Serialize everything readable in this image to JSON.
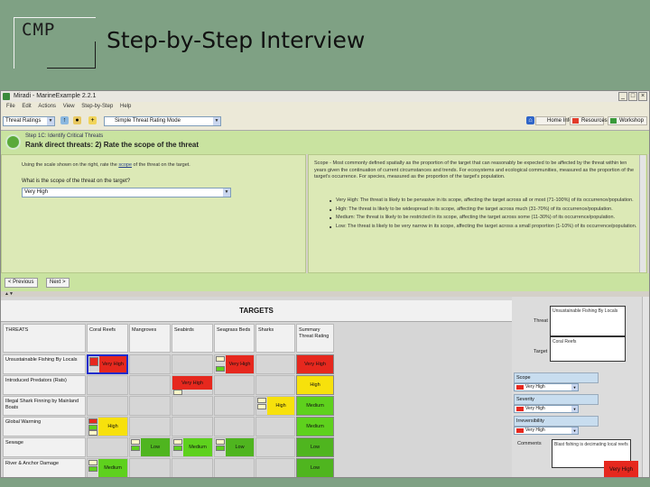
{
  "slide": {
    "logo": "CMP",
    "title": "Step-by-Step Interview"
  },
  "window": {
    "title": "Miradi - MarineExample 2.2.1",
    "menu": [
      "File",
      "Edit",
      "Actions",
      "View",
      "Step-by-Step",
      "Help"
    ]
  },
  "toolbar": {
    "view_select": "Threat Ratings",
    "mode_select": "Simple Threat Rating Mode",
    "links": [
      {
        "label": "Home Info",
        "color": "#2f65c8"
      },
      {
        "label": "Resources",
        "color": "#e23c2a"
      },
      {
        "label": "Workshop",
        "color": "#3a9a3a"
      }
    ]
  },
  "step": {
    "label": "Step 1C: Identify Critical Threats",
    "title": "Rank direct threats: 2) Rate the scope of the threat"
  },
  "question": {
    "intro_prefix": "Using the scale shown on the right, rate the",
    "intro_link": "scope",
    "intro_suffix": "of the threat on the target.",
    "text": "What is the scope of the threat on the target?",
    "answer": "Very High"
  },
  "scope_help": {
    "definition": "Scope - Most commonly defined spatially as the proportion of the target that can reasonably be expected to be affected by the threat within ten years given the continuation of current circumstances and trends. For ecosystems and ecological communities, measured as the proportion of the target's occurrence. For species, measured as the proportion of the target's population.",
    "items": [
      "Very High: The threat is likely to be pervasive in its scope, affecting the target across all or most (71-100%) of its occurrence/population.",
      "High: The threat is likely to be widespread in its scope, affecting the target across much (31-70%) of its occurrence/population.",
      "Medium: The threat is likely to be restricted in its scope, affecting the target across some (11-30%) of its occurrence/population.",
      "Low: The threat is likely to be very narrow in its scope, affecting the target across a small proportion (1-10%) of its occurrence/population."
    ]
  },
  "nav": {
    "previous": "< Previous",
    "next": "Next >"
  },
  "matrix": {
    "targets_label": "TARGETS",
    "threats_label": "THREATS",
    "summary_label": "Summary Threat Rating",
    "columns": [
      "Coral Reefs",
      "Mangroves",
      "Seabirds",
      "Seagrass Beds",
      "Sharks"
    ],
    "rows": [
      {
        "threat": "Unsustainable Fishing By Locals",
        "cells": [
          {
            "rating": "Very High",
            "color": "#e6281e"
          },
          {
            "rating": "",
            "color": ""
          },
          {
            "rating": "",
            "color": ""
          },
          {
            "rating": "Very High",
            "color": "#e6281e"
          },
          {
            "rating": "",
            "color": ""
          }
        ],
        "summary": "Very High",
        "summary_color": "#e6281e"
      },
      {
        "threat": "Introduced Predators (Rats)",
        "cells": [
          {
            "rating": "",
            "color": ""
          },
          {
            "rating": "",
            "color": ""
          },
          {
            "rating": "Very High",
            "color": "#e6281e"
          },
          {
            "rating": "",
            "color": ""
          },
          {
            "rating": "",
            "color": ""
          }
        ],
        "summary": "High",
        "summary_color": "#f7e10c"
      },
      {
        "threat": "Illegal Shark Finning by Mainland Boats",
        "cells": [
          {
            "rating": "",
            "color": ""
          },
          {
            "rating": "",
            "color": ""
          },
          {
            "rating": "",
            "color": ""
          },
          {
            "rating": "",
            "color": ""
          },
          {
            "rating": "High",
            "color": "#f7e10c"
          }
        ],
        "summary": "Medium",
        "summary_color": "#5ed11d"
      },
      {
        "threat": "Global Warming",
        "cells": [
          {
            "rating": "High",
            "color": "#f7e10c"
          },
          {
            "rating": "",
            "color": ""
          },
          {
            "rating": "",
            "color": ""
          },
          {
            "rating": "",
            "color": ""
          },
          {
            "rating": "",
            "color": ""
          }
        ],
        "summary": "Medium",
        "summary_color": "#5ed11d"
      },
      {
        "threat": "Sewage",
        "cells": [
          {
            "rating": "",
            "color": ""
          },
          {
            "rating": "Low",
            "color": "#4fb51f"
          },
          {
            "rating": "Medium",
            "color": "#5ed11d"
          },
          {
            "rating": "Low",
            "color": "#4fb51f"
          },
          {
            "rating": "",
            "color": ""
          }
        ],
        "summary": "Low",
        "summary_color": "#4fb51f"
      },
      {
        "threat": "River & Anchor Damage",
        "cells": [
          {
            "rating": "Medium",
            "color": "#5ed11d"
          },
          {
            "rating": "",
            "color": ""
          },
          {
            "rating": "",
            "color": ""
          },
          {
            "rating": "",
            "color": ""
          },
          {
            "rating": "",
            "color": ""
          }
        ],
        "summary": "Low",
        "summary_color": "#4fb51f"
      }
    ]
  },
  "detail": {
    "threat_label": "Threat",
    "threat_value": "Unsustainable Fishing By Locals",
    "target_label": "Target",
    "target_value": "Coral Reefs",
    "scope_label": "Scope",
    "scope_value": "Very High",
    "severity_label": "Severity",
    "severity_value": "Very High",
    "irreversibility_label": "Irreversibility",
    "irreversibility_value": "Very High",
    "comments_label": "Comments",
    "comments_value": "Blast fishing is decimating local reefs",
    "rating_value": "Very High"
  },
  "colors": {
    "very_high": "#e6281e",
    "high": "#f7e10c",
    "medium": "#5ed11d",
    "low": "#4fb51f",
    "panel_bg": "#dce9b6",
    "header_bg": "#c9e3a0"
  }
}
